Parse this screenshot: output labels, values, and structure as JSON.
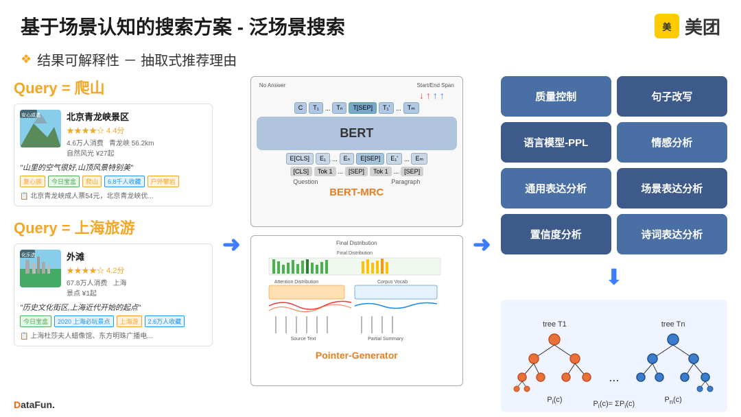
{
  "header": {
    "title": "基于场景认知的搜索方案 - 泛场景搜索",
    "logo_icon": "美",
    "logo_text": "美团"
  },
  "sub_header": {
    "diamond": "❖",
    "text": "结果可解释性 － 抽取式推荐理由"
  },
  "left": {
    "query1_label": "Query = 爬山",
    "card1_title": "北京青龙峡景区",
    "card1_location_tag": "安心成选",
    "card1_stars": "★★★★☆ 4.4分",
    "card1_meta1": "4.6万人消费",
    "card1_meta2": "青龙峡 56.2km",
    "card1_nature": "自然风光 ¥27起",
    "card1_desc": "\"山里的空气很好,山顶风景特别美\"",
    "card1_tag1": "复心族",
    "card1_tag2": "今日宝盒",
    "card1_tag3": "爬山",
    "card1_tag4": "6.8千人收藏",
    "card1_extra": "户外攀岩",
    "card1_info": "北京青龙峡成人票54元，北京青龙峡优...",
    "query2_label": "Query = 上海旅游",
    "card2_title": "外滩",
    "card2_location_tag": "化乐选",
    "card2_stars": "★★★★☆ 4.2分",
    "card2_meta1": "67.8万人消费",
    "card2_meta2": "上海",
    "card2_nature": "景点 ¥1起",
    "card2_desc": "\"历史文化街区,上海近代开始的起点\"",
    "card2_tag1": "今日宝盒",
    "card2_tag2": "2020 上海必玩景点",
    "card2_tag3": "上海游",
    "card2_tag4": "2.6万人收藏",
    "card2_info": "上海杜莎夫人蜡像馆、东方明珠广播电..."
  },
  "middle": {
    "bert_title": "BERT",
    "no_answer_label": "No Answer",
    "start_end_span_label": "Start/End Span",
    "bert_mrc_label": "BERT-MRC",
    "question_label": "Question",
    "paragraph_label": "Paragraph",
    "pointer_label": "Pointer-Generator",
    "final_distribution_label": "Final Distribution",
    "copy_vocab_label": "Corpus Vocab",
    "attention_label": "Attention Distribution",
    "source_text_label": "Source Text",
    "partial_summary_label": "Partial Summary"
  },
  "right": {
    "buttons": [
      "质量控制",
      "句子改写",
      "语言模型-PPL",
      "情感分析",
      "通用表达分析",
      "场景表达分析",
      "置信度分析",
      "诗词表达分析"
    ],
    "tree_label1": "tree T1",
    "tree_label2": "tree Tn",
    "formula": "P_i(c) = ΣP_i(c)"
  },
  "datafun": {
    "prefix": "D",
    "rest": "ataFun."
  }
}
